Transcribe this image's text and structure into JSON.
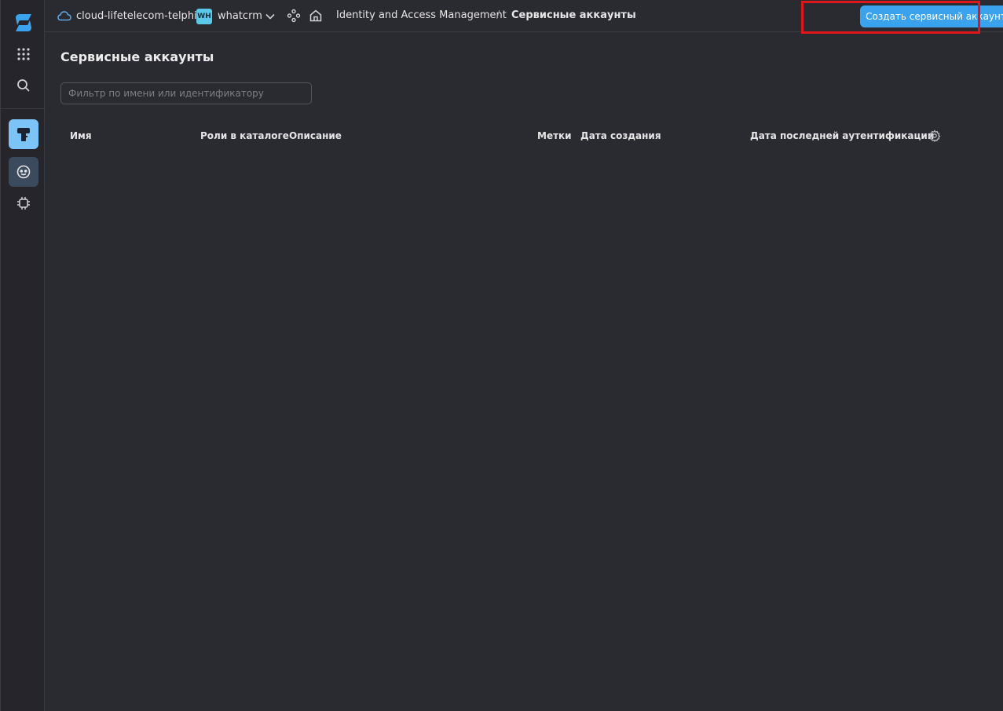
{
  "topbar": {
    "cloud_name": "cloud-lifetelecom-telphin",
    "folder_badge": "WH",
    "folder_name": "whatcrm",
    "breadcrumb": [
      "Identity and Access Management",
      "Сервисные аккаунты"
    ],
    "breadcrumb_separator": "/",
    "create_button": "Создать сервисный аккаунт"
  },
  "rail": {
    "icons": [
      "logo-icon",
      "apps-grid-icon",
      "search-icon",
      "iam-key-icon",
      "service-account-robot-icon",
      "chip-settings-icon"
    ]
  },
  "main": {
    "title": "Сервисные аккаунты",
    "filter_placeholder": "Фильтр по имени или идентификатору",
    "filter_value": "",
    "columns": [
      "Имя",
      "Роли в каталоге",
      "Описание",
      "Метки",
      "Дата создания",
      "Дата последней аутентификации"
    ],
    "rows": []
  },
  "colors": {
    "background": "#2a2a31",
    "accent": "#3ba3ee",
    "highlight": "#e0161b",
    "badge": "#5bc8e8"
  }
}
